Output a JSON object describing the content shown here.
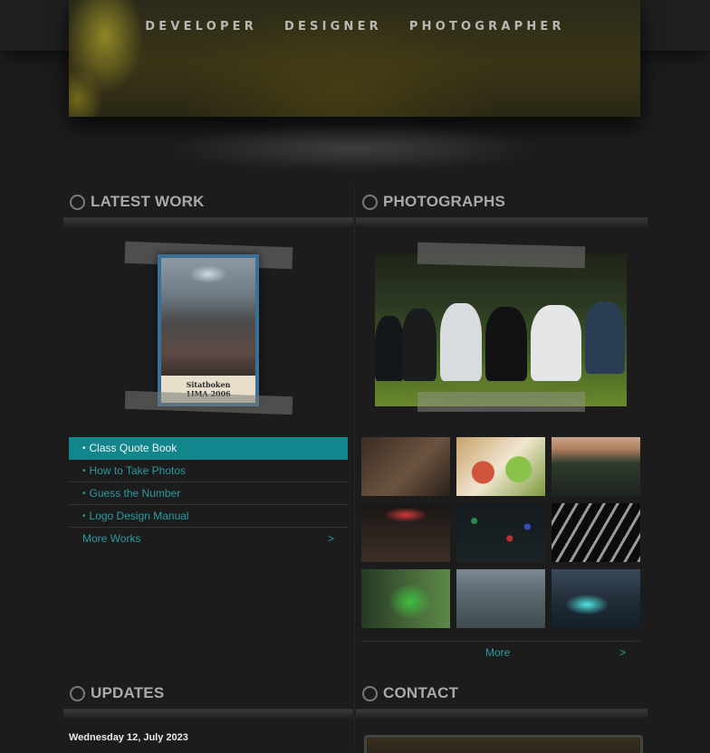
{
  "header": {
    "nav": [
      "DEVELOPER",
      "DESIGNER",
      "PHOTOGRAPHER"
    ]
  },
  "latest_work": {
    "title": "LATEST WORK",
    "feature": {
      "line1": "Sitatboken",
      "line2": "1IMA 2006"
    },
    "items": [
      {
        "label": "Class Quote Book",
        "active": true
      },
      {
        "label": "How to Take Photos",
        "active": false
      },
      {
        "label": "Guess the Number",
        "active": false
      },
      {
        "label": "Logo Design Manual",
        "active": false
      }
    ],
    "more_label": "More Works",
    "more_arrow": ">"
  },
  "photographs": {
    "title": "PHOTOGRAPHS",
    "more_label": "More",
    "more_arrow": ">"
  },
  "updates": {
    "title": "UPDATES",
    "date": "Wednesday 12, July 2023"
  },
  "contact": {
    "title": "CONTACT"
  },
  "colors": {
    "accent": "#11878d",
    "link": "#2a9aa0",
    "background": "#1c1c1d"
  }
}
